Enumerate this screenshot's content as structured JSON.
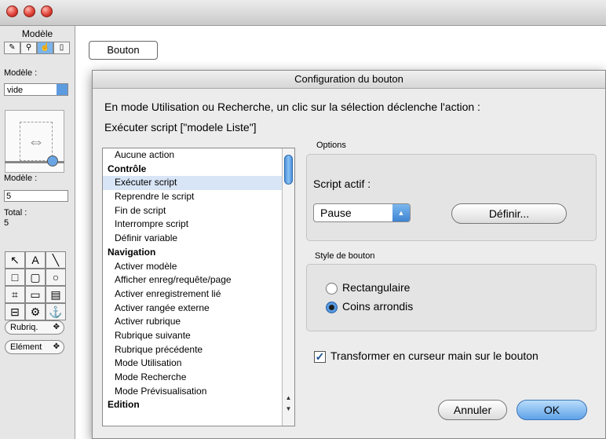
{
  "palette": {
    "title": "Modèle",
    "mode_icons": [
      "✎",
      "⚲",
      "☝",
      "▯"
    ],
    "model_label": "Modèle :",
    "model_select": "vide",
    "model_num_label": "Modèle :",
    "model_num_value": "5",
    "total_label": "Total :",
    "total_value": "5",
    "tools": [
      "↖",
      "A",
      "╲",
      "□",
      "▢",
      "○",
      "⌗",
      "▭",
      "▤",
      "⊟",
      "⚙",
      "⚓"
    ],
    "field_button": "Rubriq.",
    "element_button": "Elément"
  },
  "layout": {
    "button_label": "Bouton"
  },
  "dialog": {
    "title": "Configuration du bouton",
    "intro": "En mode Utilisation ou Recherche, un clic sur la sélection déclenche l'action :",
    "script_line": "Exécuter script [\"modele Liste\"]",
    "actions": [
      {
        "label": "Aucune action",
        "type": "item"
      },
      {
        "label": "Contrôle",
        "type": "header"
      },
      {
        "label": "Exécuter script",
        "type": "selected"
      },
      {
        "label": "Reprendre le script",
        "type": "item"
      },
      {
        "label": "Fin de script",
        "type": "item"
      },
      {
        "label": "Interrompre script",
        "type": "item"
      },
      {
        "label": "Définir variable",
        "type": "item"
      },
      {
        "label": "Navigation",
        "type": "header"
      },
      {
        "label": "Activer modèle",
        "type": "item"
      },
      {
        "label": "Afficher enreg/requête/page",
        "type": "item"
      },
      {
        "label": "Activer enregistrement lié",
        "type": "item"
      },
      {
        "label": "Activer rangée externe",
        "type": "item"
      },
      {
        "label": "Activer rubrique",
        "type": "item"
      },
      {
        "label": "Rubrique suivante",
        "type": "item"
      },
      {
        "label": "Rubrique précédente",
        "type": "item"
      },
      {
        "label": "Mode Utilisation",
        "type": "item"
      },
      {
        "label": "Mode Recherche",
        "type": "item"
      },
      {
        "label": "Mode Prévisualisation",
        "type": "item"
      },
      {
        "label": "Edition",
        "type": "header"
      }
    ],
    "options_label": "Options",
    "script_actif_label": "Script actif :",
    "pause_value": "Pause",
    "definir_button": "Définir...",
    "style_label": "Style de bouton",
    "radio_rect": "Rectangulaire",
    "radio_round": "Coins arrondis",
    "selected_style": "Coins arrondis",
    "checkbox_label": "Transformer en curseur main sur le bouton",
    "checkbox_checked": true,
    "cancel_button": "Annuler",
    "ok_button": "OK"
  },
  "colors": {
    "accent": "#5ea2e8",
    "selection": "#d8e5f6"
  }
}
